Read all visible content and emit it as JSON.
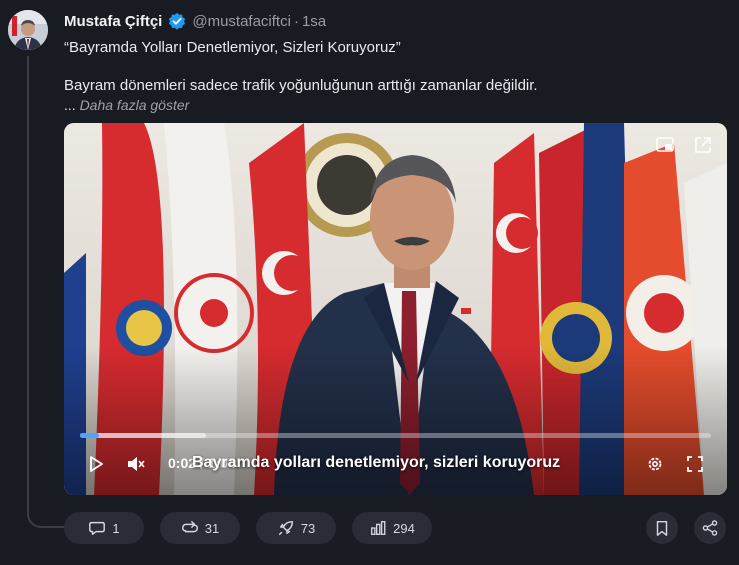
{
  "post": {
    "author": "Mustafa Çiftçi",
    "handle": "@mustafaciftci",
    "separator": "·",
    "time": "1sa",
    "title_line": "“Bayramda Yolları Denetlemiyor, Sizleri Koruyoruz”",
    "body_line": "Bayram dönemleri sadece trafik yoğunluğunun arttığı zamanlar değildir.",
    "ellipsis": "...",
    "show_more": "Daha fazla göster"
  },
  "video": {
    "current_time": "0:02",
    "duration_sep": "/",
    "duration": "1:04",
    "subtitle": "Bayramda yolları denetlemiyor, sizleri koruyoruz",
    "progress_fraction": 0.03,
    "buffered_fraction": 0.2
  },
  "actions": {
    "replies": "1",
    "reposts": "31",
    "likes": "73",
    "views": "294"
  },
  "colors": {
    "background": "#191b22",
    "pill": "#2a2d36",
    "verified": "#1d9bf0",
    "progress": "#4da3ff"
  },
  "icons": [
    "verified-badge-icon",
    "pip-icon",
    "external-link-icon",
    "play-icon",
    "mute-icon",
    "settings-icon",
    "fullscreen-icon",
    "reply-icon",
    "repost-icon",
    "rocket-icon",
    "views-icon",
    "bookmark-icon",
    "share-icon"
  ]
}
